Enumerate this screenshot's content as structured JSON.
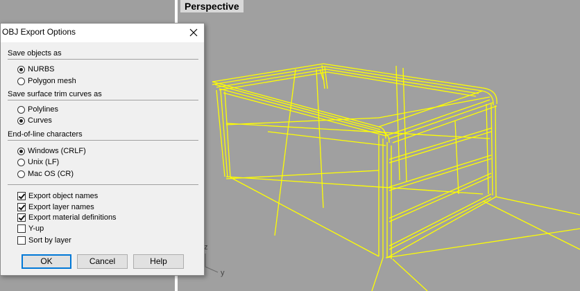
{
  "viewport": {
    "label": "Perspective",
    "axis_z": "z",
    "axis_y": "y"
  },
  "colors": {
    "wireframe": "#ffff00",
    "viewport_bg": "#a0a0a0"
  },
  "dialog": {
    "title": "OBJ Export Options",
    "close_icon": "close-icon",
    "sections": {
      "save_objects": "Save objects as",
      "trim_curves": "Save surface trim curves as",
      "eol": "End-of-line characters"
    },
    "save_objects": [
      {
        "label": "NURBS",
        "selected": true
      },
      {
        "label": "Polygon mesh",
        "selected": false
      }
    ],
    "trim_curves": [
      {
        "label": "Polylines",
        "selected": false
      },
      {
        "label": "Curves",
        "selected": true
      }
    ],
    "eol": [
      {
        "label": "Windows (CRLF)",
        "selected": true
      },
      {
        "label": "Unix (LF)",
        "selected": false
      },
      {
        "label": "Mac OS (CR)",
        "selected": false
      }
    ],
    "checks": [
      {
        "label": "Export object names",
        "checked": true
      },
      {
        "label": "Export layer names",
        "checked": true
      },
      {
        "label": "Export material definitions",
        "checked": true
      },
      {
        "label": "Y-up",
        "checked": false
      },
      {
        "label": "Sort by layer",
        "checked": false
      }
    ],
    "buttons": {
      "ok": "OK",
      "cancel": "Cancel",
      "help": "Help"
    }
  }
}
